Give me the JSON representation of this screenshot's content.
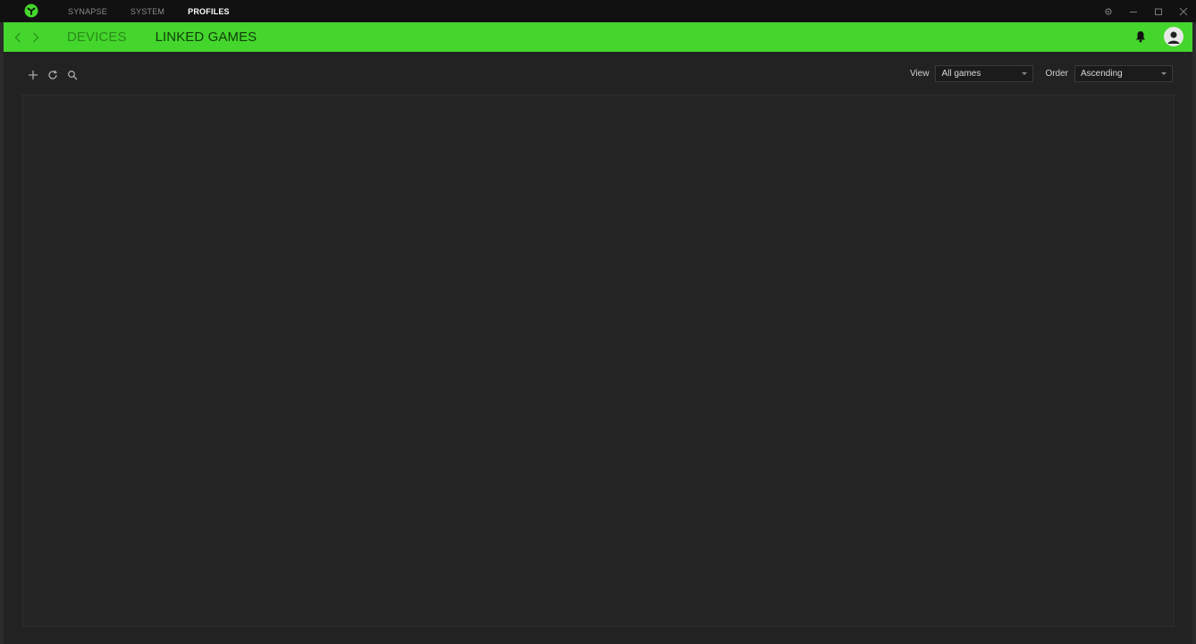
{
  "topnav": {
    "items": [
      {
        "label": "SYNAPSE"
      },
      {
        "label": "SYSTEM"
      },
      {
        "label": "PROFILES"
      }
    ]
  },
  "subnav": {
    "tabs": [
      {
        "label": "DEVICES"
      },
      {
        "label": "LINKED GAMES"
      }
    ]
  },
  "filters": {
    "view_label": "View",
    "view_value": "All games",
    "order_label": "Order",
    "order_value": "Ascending"
  },
  "icons": {
    "logo": "razer-logo-icon",
    "settings": "gear-icon",
    "minimize": "minimize-icon",
    "restore": "restore-icon",
    "close": "close-icon",
    "back": "chevron-left-icon",
    "forward": "chevron-right-icon",
    "bell": "bell-icon",
    "avatar": "user-avatar-icon",
    "add": "plus-icon",
    "refresh": "refresh-icon",
    "search": "search-icon"
  },
  "colors": {
    "accent": "#44d62c",
    "titlebar": "#111111",
    "background": "#222222"
  }
}
